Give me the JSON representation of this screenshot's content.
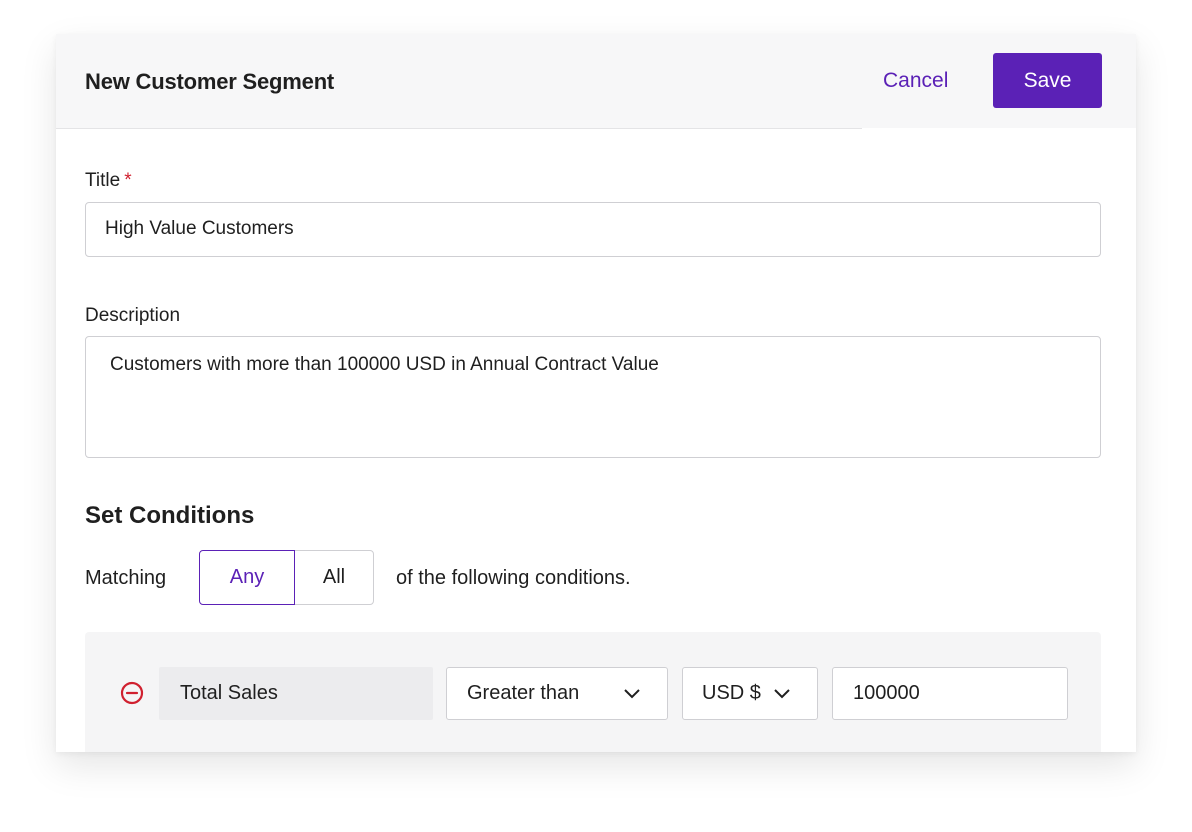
{
  "header": {
    "title": "New Customer Segment",
    "cancel_label": "Cancel",
    "save_label": "Save"
  },
  "form": {
    "title_label": "Title",
    "required_marker": "*",
    "title_value": "High Value Customers",
    "description_label": "Description",
    "description_value": "Customers with more than 100000 USD in Annual Contract Value"
  },
  "conditions": {
    "section_title": "Set Conditions",
    "matching_label": "Matching",
    "options": [
      "Any",
      "All"
    ],
    "selected_option": "Any",
    "suffix": "of the following conditions.",
    "rows": [
      {
        "field": "Total Sales",
        "operator": "Greater than",
        "currency": "USD $",
        "value": "100000"
      }
    ]
  },
  "icons": {
    "remove": "minus-circle-icon",
    "dropdown": "chevron-down-icon"
  },
  "colors": {
    "accent": "#5b21b6",
    "danger": "#d0202f",
    "header_bg": "#f7f7f8",
    "panel_bg": "#f5f5f6"
  }
}
